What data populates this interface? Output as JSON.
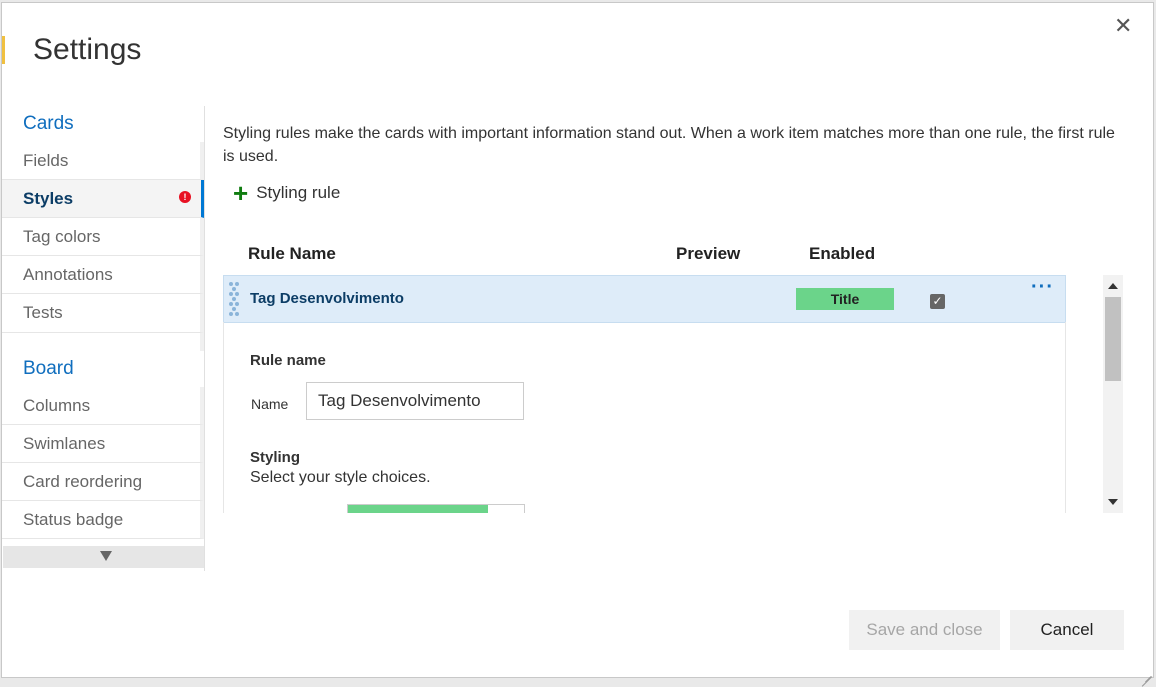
{
  "dialog": {
    "title": "Settings",
    "close_icon": "close-icon"
  },
  "nav": {
    "sections": [
      {
        "label": "Cards",
        "items": [
          "Fields",
          "Styles",
          "Tag colors",
          "Annotations",
          "Tests"
        ]
      },
      {
        "label": "Board",
        "items": [
          "Columns",
          "Swimlanes",
          "Card reordering",
          "Status badge"
        ]
      }
    ],
    "active_item": "Styles",
    "error_badge": "!"
  },
  "main": {
    "intro": "Styling rules make the cards with important information stand out. When a work item matches more than one rule, the first rule is used.",
    "add_rule_label": "Styling rule",
    "columns": {
      "rule_name": "Rule Name",
      "preview": "Preview",
      "enabled": "Enabled"
    },
    "rule": {
      "name": "Tag Desenvolvimento",
      "preview_label": "Title",
      "preview_color": "#6bd48a",
      "enabled": true,
      "more": "···"
    },
    "details": {
      "rule_name_heading": "Rule name",
      "name_label": "Name",
      "name_value": "Tag Desenvolvimento",
      "styling_heading": "Styling",
      "styling_desc": "Select your style choices.",
      "card_color": "#6bd48a"
    }
  },
  "footer": {
    "save_label": "Save and close",
    "cancel_label": "Cancel"
  },
  "colors": {
    "accent": "#0078d4",
    "section_blue": "#106ebe",
    "selected_row": "#deecf9"
  }
}
